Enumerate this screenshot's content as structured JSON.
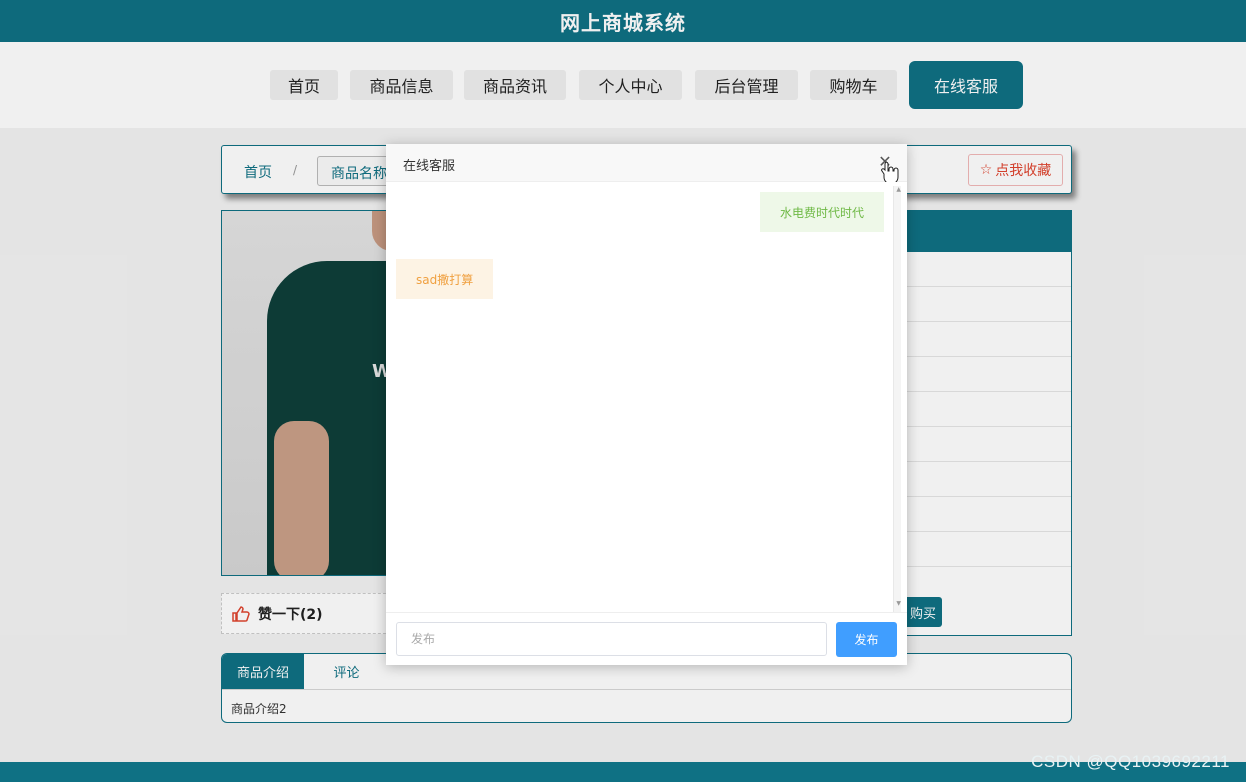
{
  "app": {
    "title": "网上商城系统"
  },
  "nav": {
    "items": [
      {
        "label": "首页"
      },
      {
        "label": "商品信息"
      },
      {
        "label": "商品资讯"
      },
      {
        "label": "个人中心"
      },
      {
        "label": "后台管理"
      },
      {
        "label": "购物车"
      },
      {
        "label": "在线客服",
        "active": true
      }
    ]
  },
  "breadcrumb": {
    "home": "首页",
    "separator": "/",
    "current": "商品名称"
  },
  "favorite": {
    "label": "点我收藏",
    "icon": "star-outline-icon"
  },
  "like": {
    "label": "赞一下(2)",
    "icon": "thumbs-up-icon"
  },
  "product": {
    "image_text": "W"
  },
  "buy": {
    "label": "购买"
  },
  "tabs": {
    "items": [
      {
        "label": "商品介绍",
        "active": true
      },
      {
        "label": "评论"
      }
    ],
    "content": "商品介绍2"
  },
  "dialog": {
    "title": "在线客服",
    "close_icon": "close-icon",
    "messages": [
      {
        "side": "right",
        "text": "水电费时代时代"
      },
      {
        "side": "left",
        "text": "sad撒打算"
      }
    ],
    "input": {
      "placeholder": "发布",
      "value": ""
    },
    "send_label": "发布"
  },
  "watermark": "CSDN @QQ1039692211",
  "colors": {
    "primary": "#0f7184",
    "send": "#409eff",
    "fav": "#e0442f"
  }
}
